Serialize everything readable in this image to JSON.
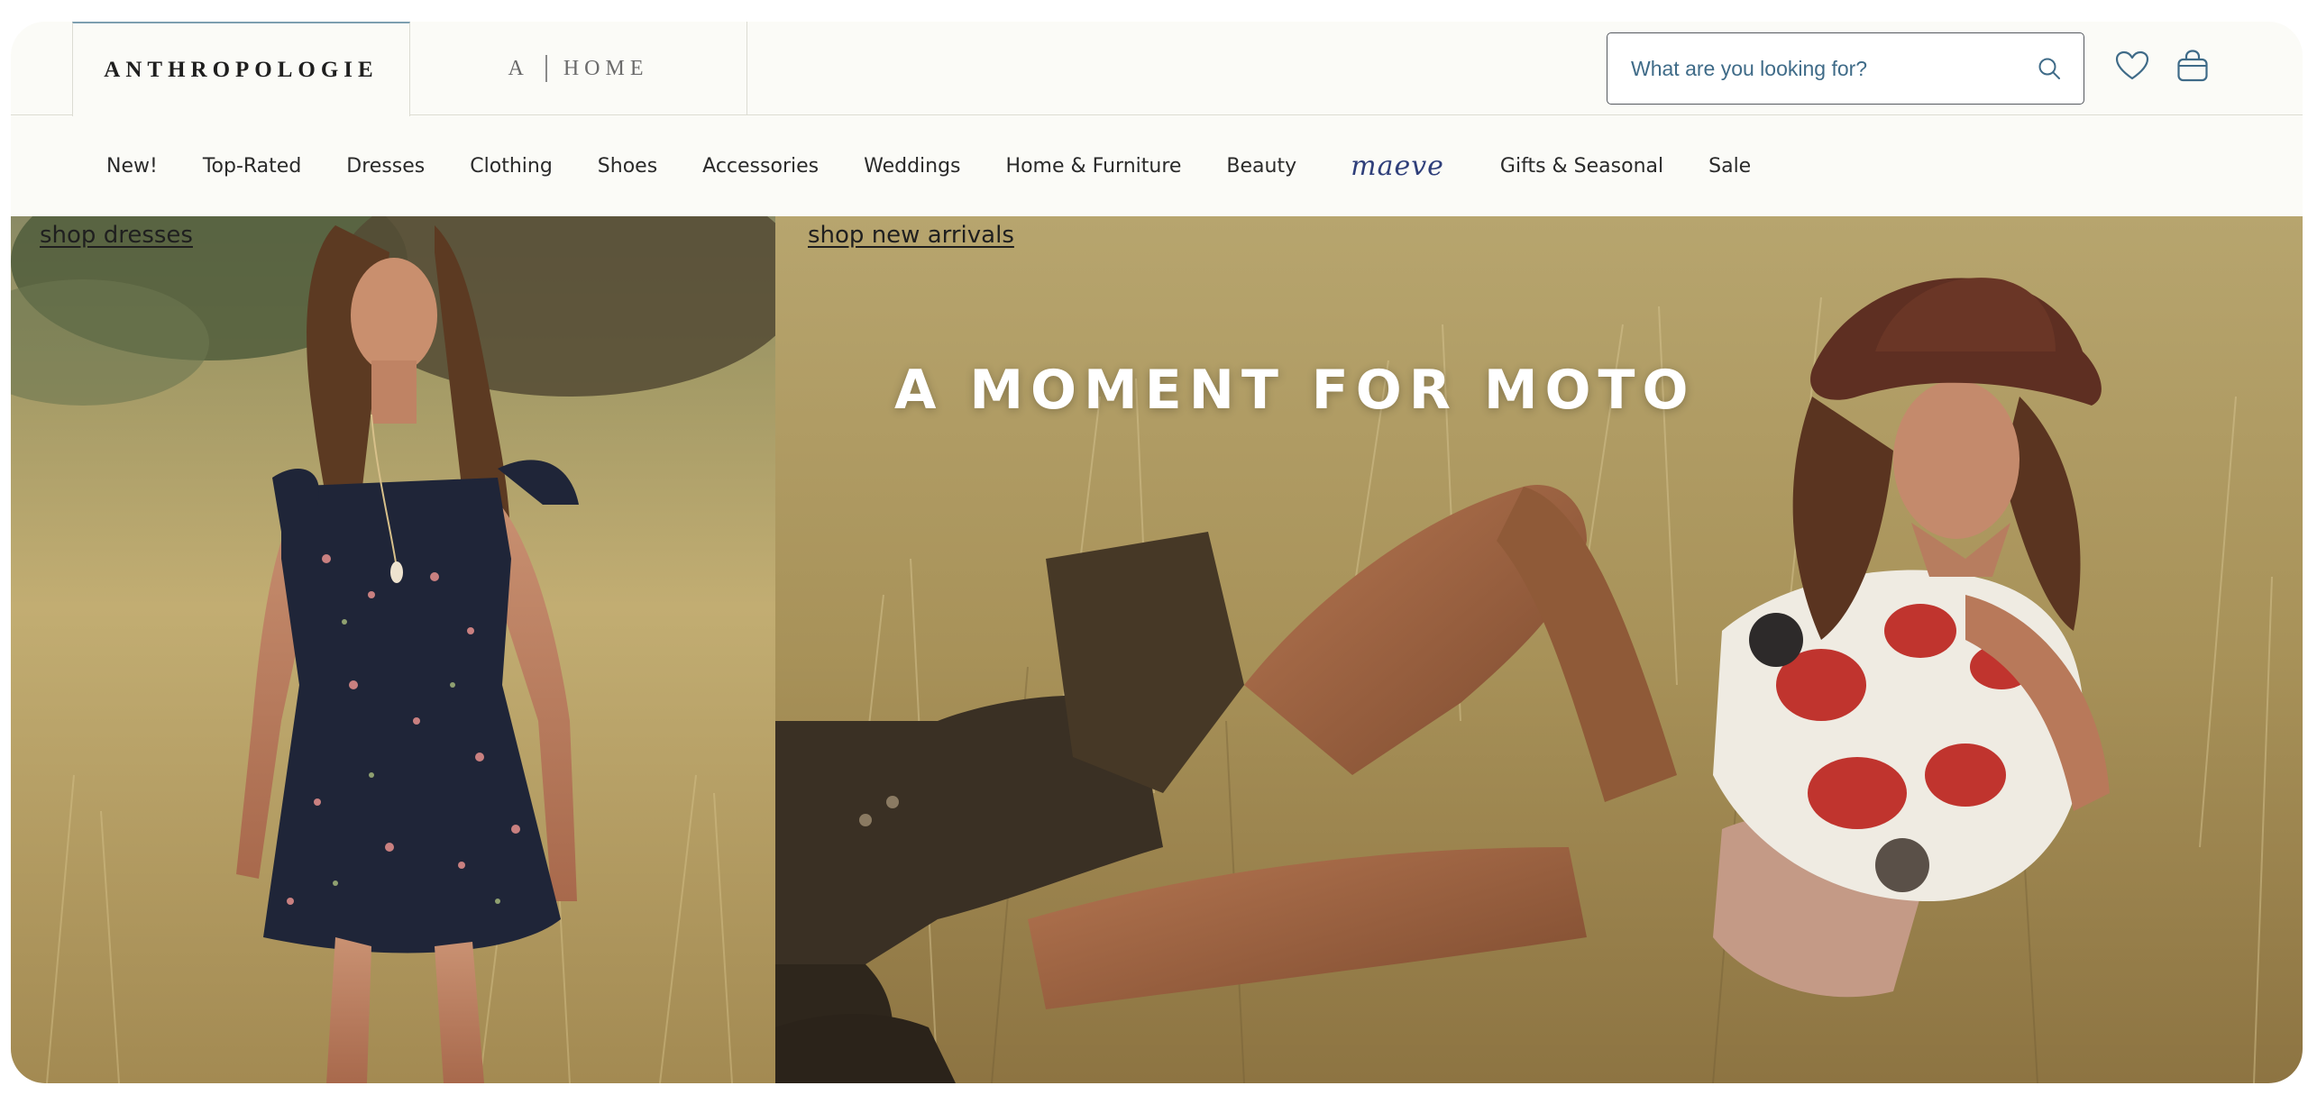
{
  "header": {
    "brand_tabs": [
      {
        "label": "ANTHROPOLOGIE"
      },
      {
        "prefix": "A",
        "label": "HOME"
      }
    ],
    "search": {
      "placeholder": "What are you looking for?",
      "icon": "search-icon"
    },
    "icons": [
      "heart-icon",
      "shopping-bag-icon"
    ]
  },
  "nav": {
    "items": [
      "New!",
      "Top-Rated",
      "Dresses",
      "Clothing",
      "Shoes",
      "Accessories",
      "Weddings",
      "Home & Furniture",
      "Beauty",
      "maeve",
      "Gifts & Seasonal",
      "Sale"
    ]
  },
  "hero": {
    "left": {
      "link": "shop dresses"
    },
    "right": {
      "link": "shop new arrivals",
      "headline": "A MOMENT FOR MOTO"
    }
  },
  "colors": {
    "page_bg": "#fbfbf7",
    "accent_blue": "#7d9fb0",
    "search_text": "#3f6b88",
    "maeve_navy": "#2f3f7a"
  }
}
